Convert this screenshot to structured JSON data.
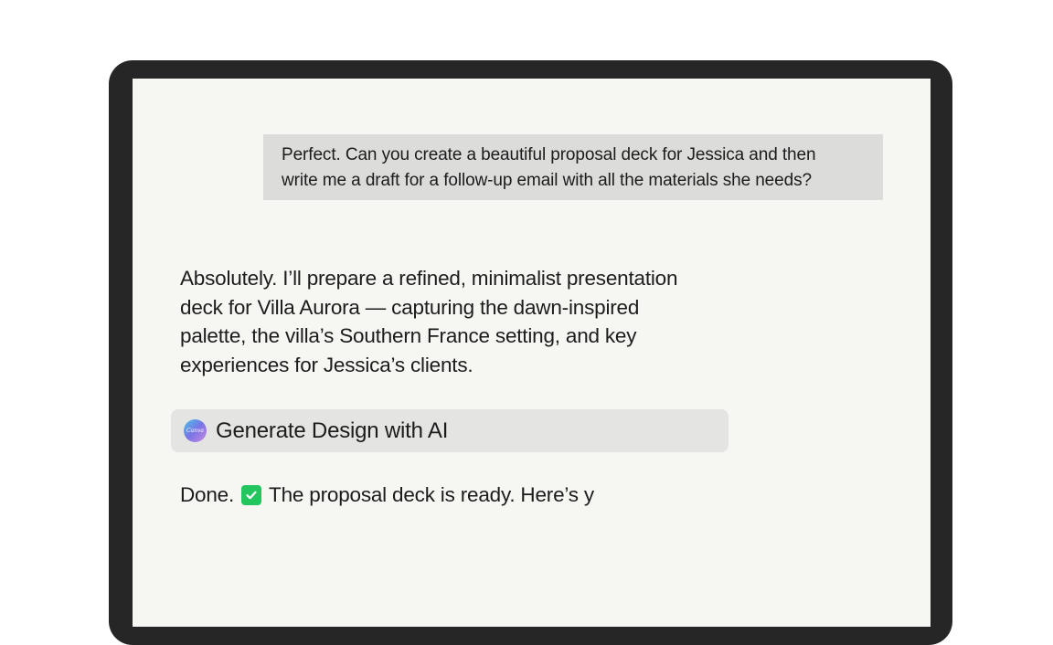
{
  "chat": {
    "user_message": {
      "lines": [
        "Perfect. Can you create a beautiful proposal deck for Jessica and then",
        "write me a draft for a follow-up email with all the materials she needs?"
      ]
    },
    "assistant_message": {
      "lines": [
        "Absolutely. I’ll prepare a refined, minimalist presentation",
        "deck for Villa Aurora — capturing the dawn-inspired",
        "palette, the villa’s Southern France setting, and key",
        "experiences for Jessica’s clients."
      ]
    },
    "tool_call": {
      "icon": "canva-logo-icon",
      "icon_text": "Canva",
      "label": "Generate Design with AI"
    },
    "status_message": {
      "prefix": "Done.",
      "icon": "check-icon",
      "text": "The proposal deck is ready. Here’s y"
    }
  },
  "colors": {
    "device_frame": "#262626",
    "screen_background": "#f6f6f2",
    "user_bubble": "#dcdcdb",
    "tool_chip": "#e4e4e3",
    "check": "#22c55e"
  }
}
